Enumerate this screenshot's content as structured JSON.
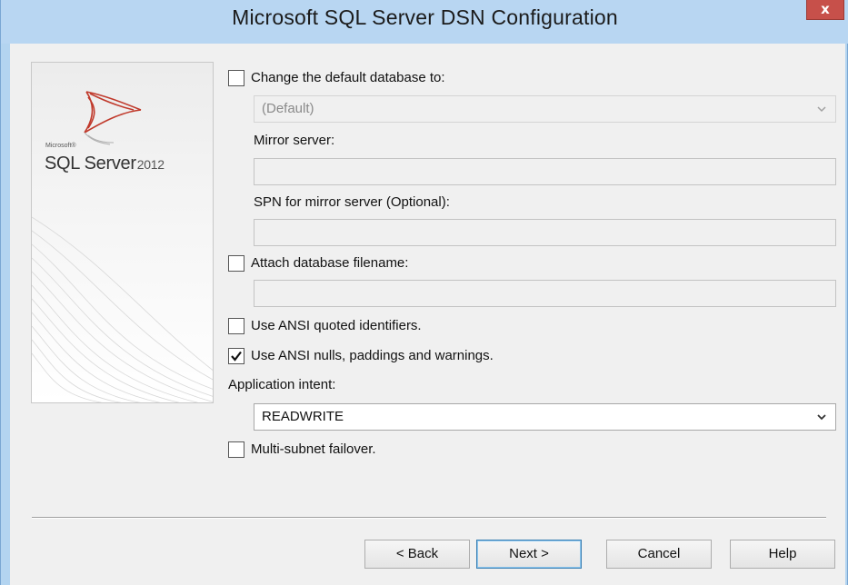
{
  "window": {
    "title": "Microsoft SQL Server DSN Configuration",
    "close_label": "x"
  },
  "banner": {
    "brand_small": "Microsoft®",
    "product": "SQL Server",
    "version": "2012"
  },
  "options": {
    "change_default_db": {
      "label": "Change the default database to:",
      "checked": false
    },
    "default_db_select": {
      "value": "(Default)",
      "enabled": false
    },
    "mirror_server": {
      "label": "Mirror server:",
      "value": ""
    },
    "spn_mirror": {
      "label": "SPN for mirror server (Optional):",
      "value": ""
    },
    "attach_db": {
      "label": "Attach database filename:",
      "checked": false,
      "value": ""
    },
    "ansi_quoted": {
      "label": "Use ANSI quoted identifiers.",
      "checked": false
    },
    "ansi_nulls": {
      "label": "Use ANSI nulls, paddings and warnings.",
      "checked": true
    },
    "app_intent": {
      "label": "Application intent:",
      "value": "READWRITE"
    },
    "multi_subnet": {
      "label": "Multi-subnet failover.",
      "checked": false
    }
  },
  "buttons": {
    "back": "< Back",
    "next": "Next >",
    "cancel": "Cancel",
    "help": "Help"
  },
  "colors": {
    "title_bar": "#b8d6f2",
    "close_button": "#c7504a",
    "logo_red": "#c0392b"
  }
}
